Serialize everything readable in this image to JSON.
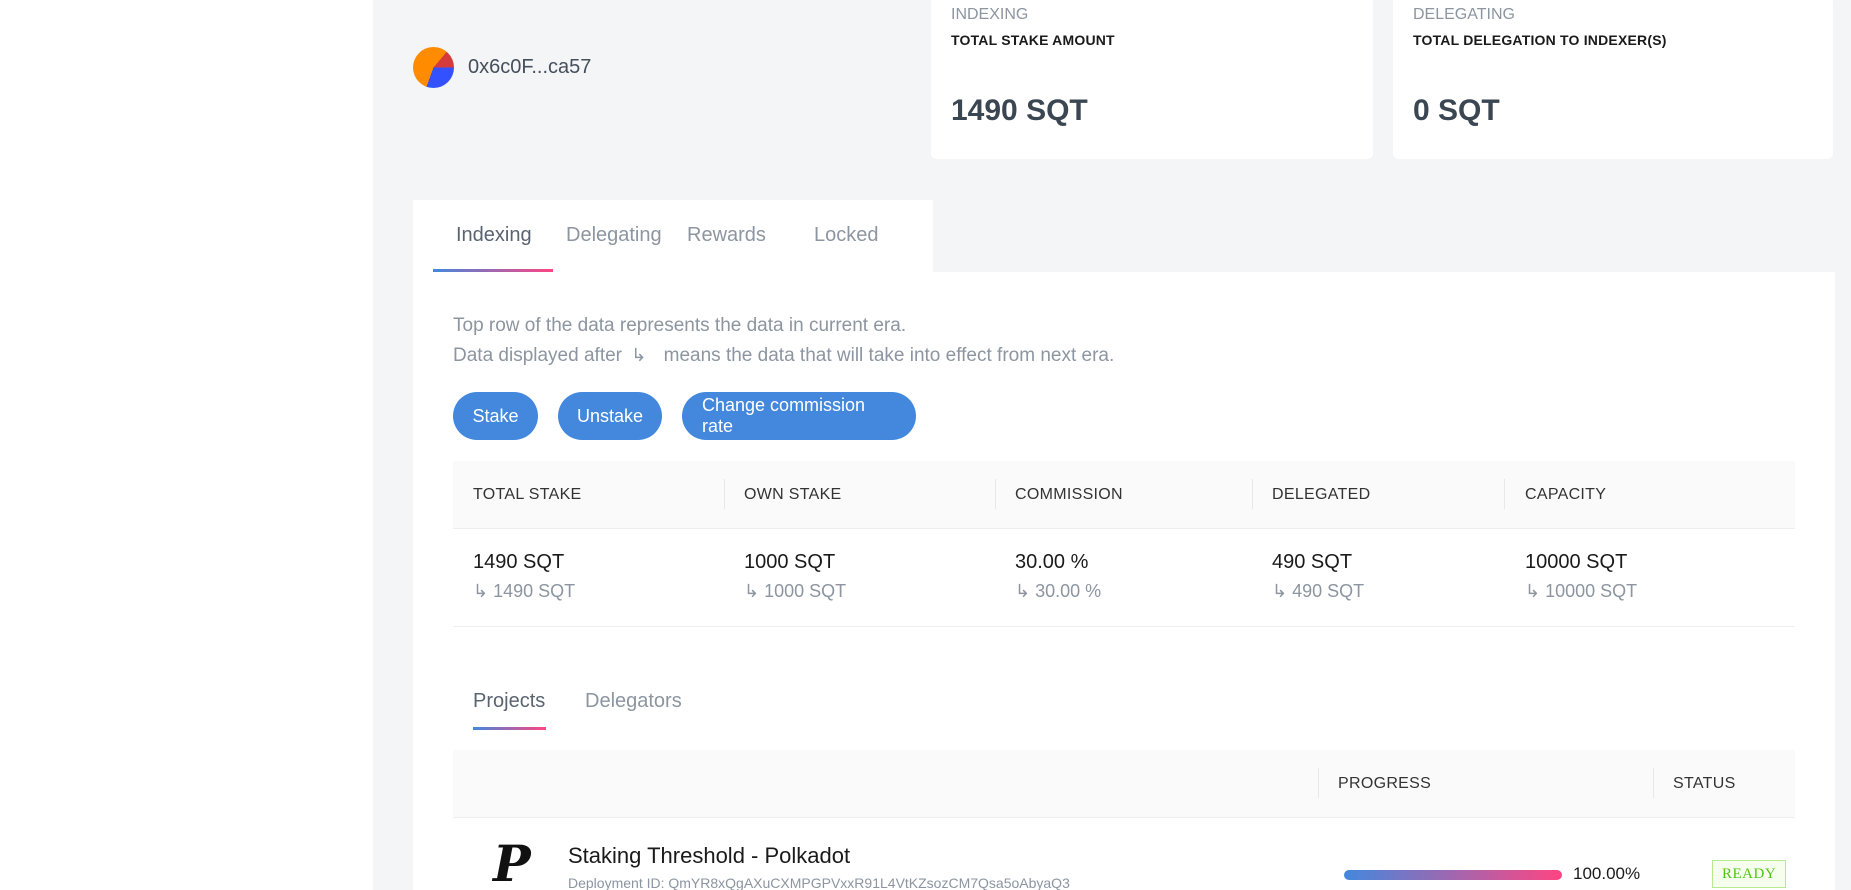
{
  "account": {
    "address": "0x6c0F...ca57"
  },
  "cards": {
    "indexing": {
      "category": "INDEXING",
      "label": "TOTAL STAKE AMOUNT",
      "value": "1490 SQT"
    },
    "delegating": {
      "category": "DELEGATING",
      "label": "TOTAL DELEGATION TO INDEXER(S)",
      "value": "0 SQT"
    }
  },
  "tabs": [
    {
      "label": "Indexing",
      "active": true
    },
    {
      "label": "Delegating",
      "active": false
    },
    {
      "label": "Rewards",
      "active": false
    },
    {
      "label": "Locked",
      "active": false
    }
  ],
  "notes": {
    "line1": "Top row of the data represents the data in current era.",
    "line2_before": "Data displayed after",
    "line2_after": "means the data that will take into effect from next era."
  },
  "buttons": {
    "stake": "Stake",
    "unstake": "Unstake",
    "change_commission": "Change commission rate"
  },
  "stake_table": {
    "headers": [
      "TOTAL STAKE",
      "OWN STAKE",
      "COMMISSION",
      "DELEGATED",
      "CAPACITY"
    ],
    "current": [
      "1490 SQT",
      "1000 SQT",
      "30.00 %",
      "490 SQT",
      "10000 SQT"
    ],
    "next": [
      "1490 SQT",
      "1000 SQT",
      "30.00 %",
      "490 SQT",
      "10000 SQT"
    ]
  },
  "sub_tabs": [
    {
      "label": "Projects",
      "active": true
    },
    {
      "label": "Delegators",
      "active": false
    }
  ],
  "projects_table": {
    "headers": {
      "progress": "PROGRESS",
      "status": "STATUS"
    },
    "rows": [
      {
        "name": "Staking Threshold - Polkadot",
        "deployment_id": "Deployment ID: QmYR8xQgAXuCXMPGPVxxR91L4VtKZsozCM7Qsa5oAbyaQ3",
        "progress_percent": 100,
        "progress_text": "100.00%",
        "status": "READY"
      }
    ]
  },
  "colors": {
    "accent": "#4388dd",
    "gradient_end": "#ff4581",
    "status_ready": "#52c41a"
  },
  "icons": {
    "next_era_arrow": "↳",
    "project_logo": "polkadot-logo"
  }
}
